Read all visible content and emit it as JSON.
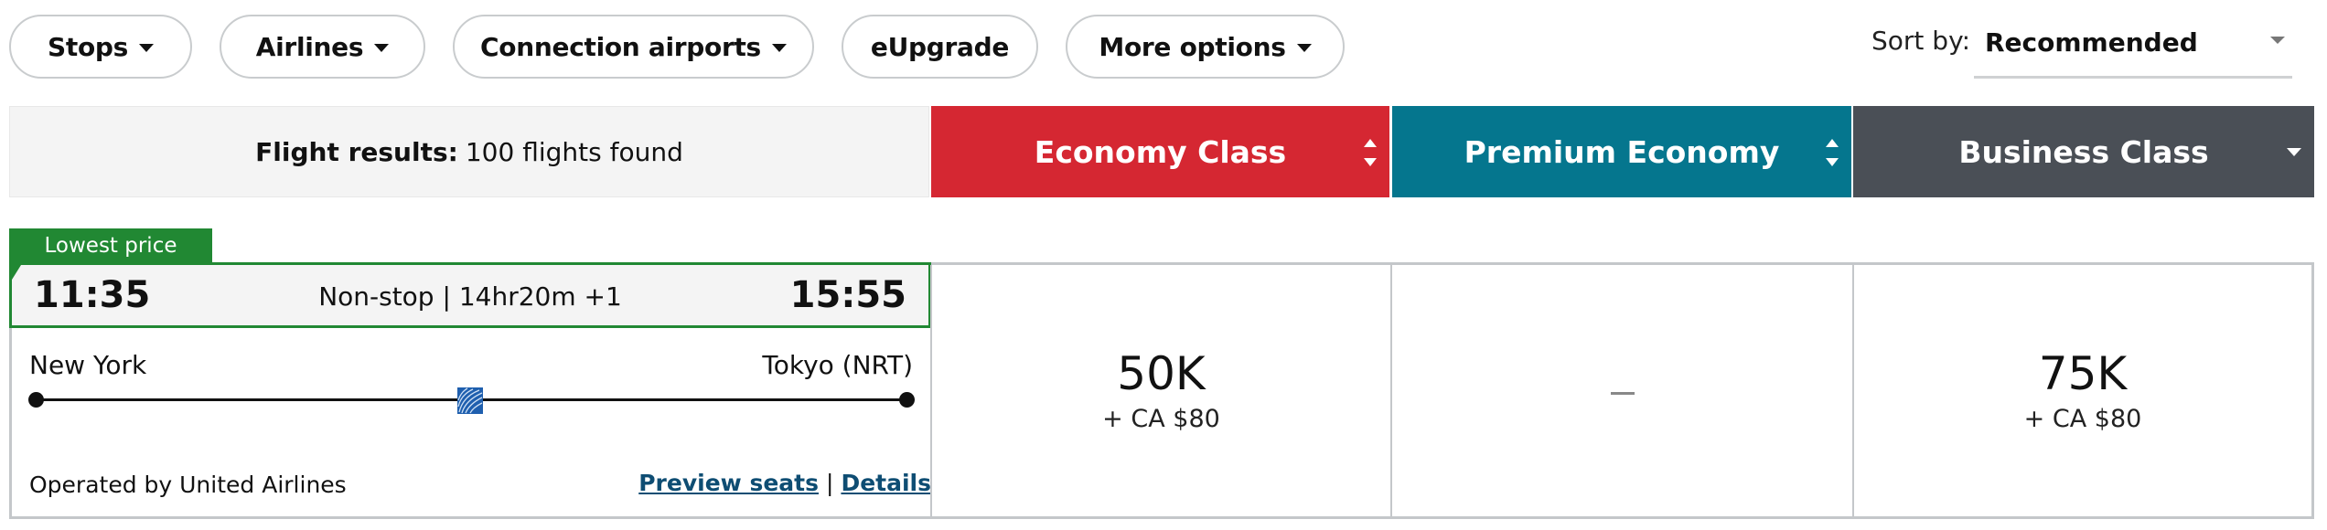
{
  "filters": [
    {
      "label": "Stops",
      "has_caret": true
    },
    {
      "label": "Airlines",
      "has_caret": true
    },
    {
      "label": "Connection airports",
      "has_caret": true
    },
    {
      "label": "eUpgrade",
      "has_caret": false
    },
    {
      "label": "More options",
      "has_caret": true
    }
  ],
  "sort": {
    "label": "Sort by:",
    "value": "Recommended"
  },
  "results": {
    "label": "Flight results:",
    "count_text": "100 flights found"
  },
  "cabins": [
    {
      "label": "Economy Class",
      "color": "#d52732",
      "sort_icon": "up-down"
    },
    {
      "label": "Premium Economy",
      "color": "#05768e",
      "sort_icon": "up-down"
    },
    {
      "label": "Business Class",
      "color": "#4a4f56",
      "sort_icon": "down"
    }
  ],
  "flight": {
    "badge": "Lowest price",
    "badge_color": "#218833",
    "depart_time": "11:35",
    "arrive_time": "15:55",
    "summary": "Non-stop | 14hr20m +1",
    "origin": "New York",
    "destination": "Tokyo (NRT)",
    "airline_logo": "united-airlines-globe-icon",
    "operated_by": "Operated by United Airlines",
    "links": {
      "preview_seats": "Preview seats",
      "separator": "|",
      "details": "Details"
    },
    "prices": [
      {
        "cabin": "Economy Class",
        "miles": "50K",
        "fee": "+ CA $80"
      },
      {
        "cabin": "Premium Economy",
        "miles": "—",
        "fee": ""
      },
      {
        "cabin": "Business Class",
        "miles": "75K",
        "fee": "+ CA $80"
      }
    ]
  }
}
